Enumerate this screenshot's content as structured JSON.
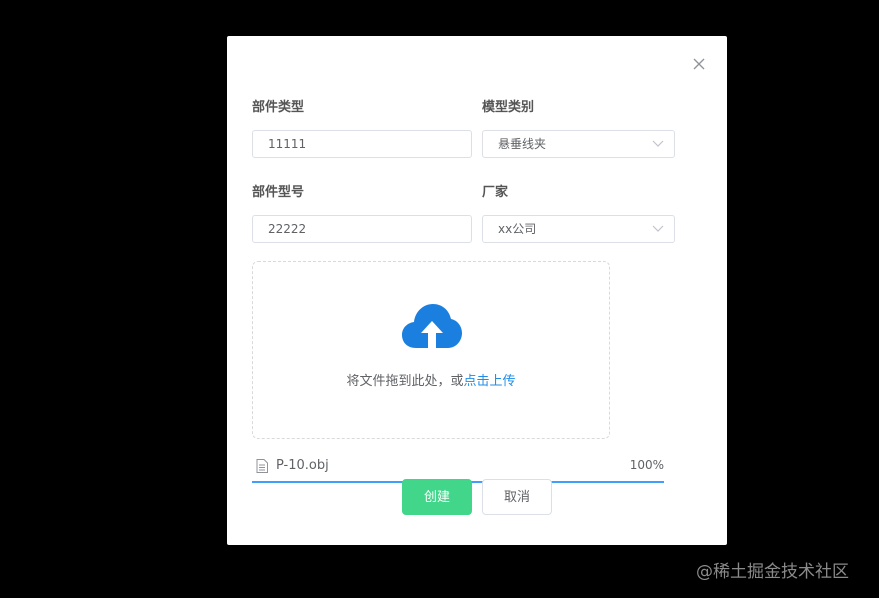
{
  "form": {
    "part_type_label": "部件类型",
    "part_type_value": "11111",
    "model_category_label": "模型类别",
    "model_category_value": "悬垂线夹",
    "part_model_label": "部件型号",
    "part_model_value": "22222",
    "manufacturer_label": "厂家",
    "manufacturer_value": "xx公司"
  },
  "upload": {
    "text_prefix": "将文件拖到此处，或",
    "text_link": "点击上传",
    "file_name": "P-10.obj",
    "progress_text": "100%",
    "progress_fraction": 1.0
  },
  "buttons": {
    "create": "创建",
    "cancel": "取消"
  },
  "watermark": "@稀土掘金技术社区",
  "colors": {
    "primary_button": "#41d68a",
    "link": "#1f8ce6",
    "cloud_icon": "#1b7fdf",
    "progress": "#409eff"
  }
}
